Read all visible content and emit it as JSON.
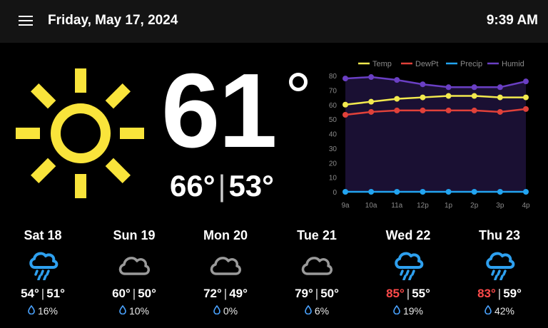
{
  "header": {
    "date": "Friday, May 17, 2024",
    "time": "9:39 AM"
  },
  "current": {
    "temp": "61",
    "high": "66°",
    "low": "53°",
    "icon": "sun-icon",
    "sun_color": "#f9e43b"
  },
  "chart_data": {
    "type": "line",
    "categories": [
      "9a",
      "10a",
      "11a",
      "12p",
      "1p",
      "2p",
      "3p",
      "4p"
    ],
    "ylim": [
      0,
      80
    ],
    "yticks": [
      "80",
      "70",
      "60",
      "50",
      "40",
      "30",
      "20",
      "10",
      "0"
    ],
    "legend_position": "top",
    "grid": false,
    "series": [
      {
        "name": "Temp",
        "color": "#f2e94e",
        "values": [
          60,
          62,
          64,
          65,
          66,
          66,
          65,
          65
        ]
      },
      {
        "name": "DewPt",
        "color": "#e0413a",
        "values": [
          53,
          55,
          56,
          56,
          56,
          56,
          55,
          57
        ]
      },
      {
        "name": "Precip",
        "color": "#22a4f0",
        "values": [
          0,
          0,
          0,
          0,
          0,
          0,
          0,
          0
        ]
      },
      {
        "name": "Humid",
        "color": "#6a3fc4",
        "values": [
          78,
          79,
          77,
          74,
          72,
          72,
          72,
          76
        ]
      }
    ]
  },
  "forecast": [
    {
      "day": "Sat 18",
      "icon": "rain-cloud-icon",
      "high": "54°",
      "low": "51°",
      "precip": "16%",
      "hot": false
    },
    {
      "day": "Sun 19",
      "icon": "cloud-icon",
      "high": "60°",
      "low": "50°",
      "precip": "10%",
      "hot": false
    },
    {
      "day": "Mon 20",
      "icon": "cloud-icon",
      "high": "72°",
      "low": "49°",
      "precip": "0%",
      "hot": false
    },
    {
      "day": "Tue 21",
      "icon": "cloud-icon",
      "high": "79°",
      "low": "50°",
      "precip": "6%",
      "hot": false
    },
    {
      "day": "Wed 22",
      "icon": "rain-cloud-icon",
      "high": "85°",
      "low": "55°",
      "precip": "19%",
      "hot": true
    },
    {
      "day": "Thu 23",
      "icon": "rain-cloud-icon",
      "high": "83°",
      "low": "59°",
      "precip": "42%",
      "hot": true
    }
  ],
  "colors": {
    "rain_icon": "#2ea0ef",
    "cloud_icon": "#9a9a9a",
    "hot_temp": "#ff4a4a"
  }
}
